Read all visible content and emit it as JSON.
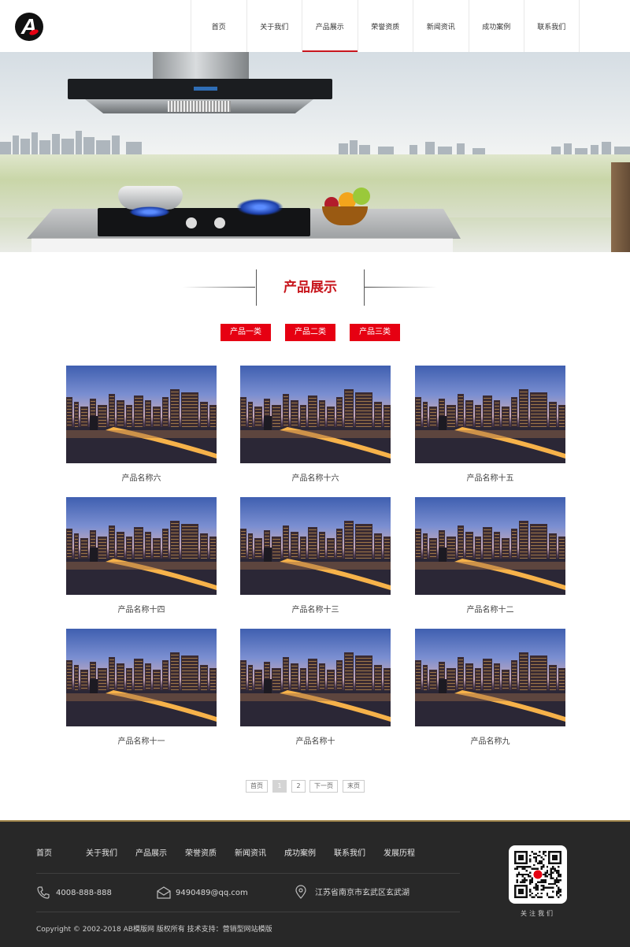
{
  "header": {
    "nav": [
      {
        "label": "首页"
      },
      {
        "label": "关于我们"
      },
      {
        "label": "产品展示"
      },
      {
        "label": "荣誉资质"
      },
      {
        "label": "新闻资讯"
      },
      {
        "label": "成功案例"
      },
      {
        "label": "联系我们"
      }
    ],
    "active_index": 2
  },
  "section": {
    "title": "产品展示",
    "categories": [
      {
        "label": "产品一类"
      },
      {
        "label": "产品二类"
      },
      {
        "label": "产品三类"
      }
    ]
  },
  "products": [
    {
      "name": "产品名称六"
    },
    {
      "name": "产品名称十六"
    },
    {
      "name": "产品名称十五"
    },
    {
      "name": "产品名称十四"
    },
    {
      "name": "产品名称十三"
    },
    {
      "name": "产品名称十二"
    },
    {
      "name": "产品名称十一"
    },
    {
      "name": "产品名称十"
    },
    {
      "name": "产品名称九"
    }
  ],
  "pagination": {
    "first": "首页",
    "pages": [
      "1",
      "2"
    ],
    "current": "1",
    "next": "下一页",
    "last": "末页"
  },
  "footer": {
    "nav": [
      {
        "label": "首页"
      },
      {
        "label": "关于我们"
      },
      {
        "label": "产品展示"
      },
      {
        "label": "荣誉资质"
      },
      {
        "label": "新闻资讯"
      },
      {
        "label": "成功案例"
      },
      {
        "label": "联系我们"
      },
      {
        "label": "发展历程"
      }
    ],
    "phone": "4008-888-888",
    "email": "9490489@qq.com",
    "address": "江苏省南京市玄武区玄武湖",
    "copyright": "Copyright © 2002-2018 AB模版网 版权所有 技术支持：营销型网站模版",
    "qr_caption": "关注我们"
  },
  "colors": {
    "accent": "#e60012",
    "footer_bg": "#282828",
    "title_red": "#c8161d"
  },
  "icons": {
    "logo": "letter-a-logo",
    "phone": "phone-icon",
    "email": "envelope-icon",
    "address": "location-pin-icon",
    "qr": "qr-code"
  }
}
